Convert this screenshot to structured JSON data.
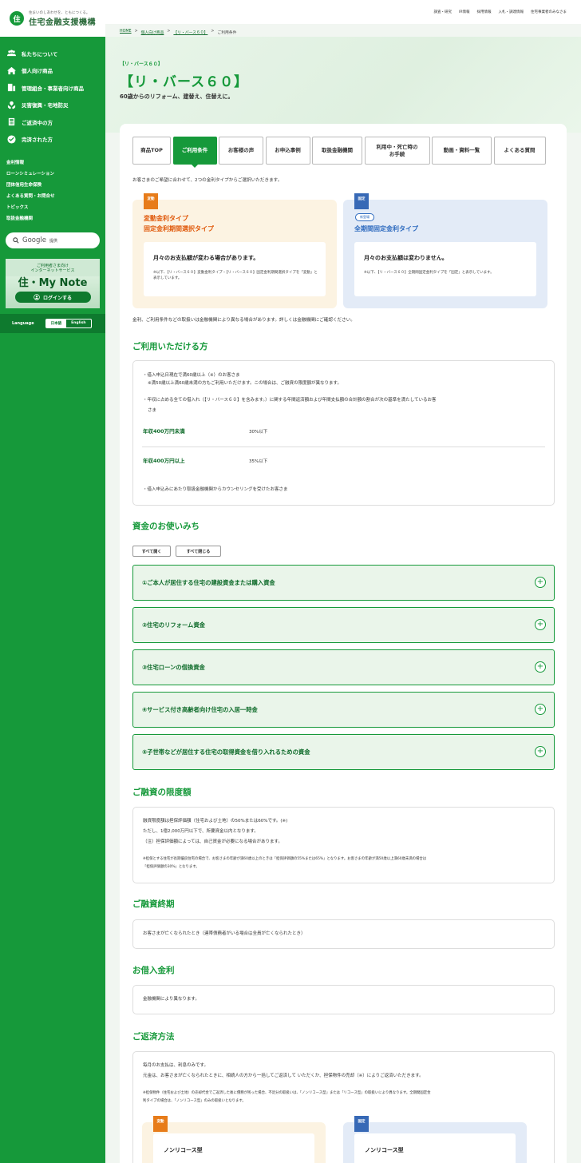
{
  "sidebar": {
    "logo_tagline": "住まいのしあわせを、ともにつくる。",
    "logo_name": "住宅金融支援機構",
    "nav": [
      {
        "label": "私たちについて",
        "icon": "people-icon"
      },
      {
        "label": "個人向け商品",
        "icon": "house-icon"
      },
      {
        "label": "管理組合・事業者向け商品",
        "icon": "building-icon"
      },
      {
        "label": "災害復興・宅地防災",
        "icon": "hands-icon"
      },
      {
        "label": "ご返済中の方",
        "icon": "calculator-icon"
      },
      {
        "label": "完済された方",
        "icon": "check-circle-icon"
      }
    ],
    "sub": [
      "金利情報",
      "ローンシミュレーション",
      "団体信用生命保険",
      "よくある質問・お問合せ",
      "トピックス",
      "取扱金融機関"
    ],
    "search_logo": "Google",
    "search_label": "提供",
    "mynote_small": "ご利用者さま向け\nインターネットサービス",
    "mynote_title": "住・My Note",
    "mynote_login": "ログインする",
    "lang_label": "Language",
    "lang_ja": "日本語",
    "lang_en": "English"
  },
  "topbar": [
    "調査・研究",
    "IR情報",
    "採用情報",
    "入札・調達情報",
    "住宅事業者のみなさま"
  ],
  "breadcrumb": {
    "home": "HOME",
    "sep": ">",
    "b1": "個人向け商品",
    "b2": "【リ・バース６０】",
    "current": "ご利用条件"
  },
  "hero": {
    "sub": "【リ・バース６０】",
    "title": "【リ・バース６０】",
    "desc": "60歳からのリフォーム、建替え、住替えに。"
  },
  "tabs": [
    "商品TOP",
    "ご利用条件",
    "お客様の声",
    "お申込事例",
    "取扱金融機関",
    "利用中・死亡時の\nお手続",
    "動画・資料一覧",
    "よくある質問"
  ],
  "intro": "お客さまのご希望に合わせて、2つの金利タイプからご選択いただきます。",
  "rate_var": {
    "tag": "変動",
    "title1": "変動金利タイプ",
    "title2": "固定金利期間選択タイプ",
    "head": "月々のお支払額が変わる場合があります。",
    "note": "※以下、【リ・バース６０】変動金利タイプ・【リ・バース６０】固定金利期間選択タイプを「変動」と表示しています。"
  },
  "rate_fix": {
    "tag": "固定",
    "new": "新登場",
    "title": "全期間固定金利タイプ",
    "head": "月々のお支払額は変わりません。",
    "note": "※以下、【リ・バース６０】全期間固定金利タイプを「固定」と表示しています。"
  },
  "rate_note": "金利、ご利用条件などの取扱いは金融機関により異なる場合があります。詳しくは金融機関にご確認ください。",
  "eligible": {
    "title": "ご利用いただける方",
    "l1": "・借入申込日現在で満60歳以上（※）のお客さま",
    "l2": "※満50歳以上満60歳未満の方もご利用いただけます。この場合は、ご融資の限度額が異なります。",
    "l3": "・年収に占める全ての借入れ（【リ・バース６０】を含みます。）に関する年間返済額および年間支払額の合計額の割合が次の基準を満たしているお客",
    "l3b": "さま",
    "row1_label": "年収400万円未満",
    "row1_val": "30%以下",
    "row2_label": "年収400万円以上",
    "row2_val": "35%以下",
    "l4": "・借入申込みにあたり取扱金融機関からカウンセリングを受けたお客さま"
  },
  "uses": {
    "title": "資金のお使いみち",
    "open_all": "すべて開く",
    "close_all": "すべて閉じる",
    "items": [
      "①ご本人が居住する住宅の建設資金または購入資金",
      "②住宅のリフォーム資金",
      "③住宅ローンの借換資金",
      "④サービス付き高齢者向け住宅の入居一時金",
      "⑤子世帯などが居住する住宅の取得資金を借り入れるための資金"
    ]
  },
  "limit": {
    "title": "ご融資の限度額",
    "l1": "融資限度額は担保評価額（住宅および土地）の50%または60%です。(※)",
    "l2": "ただし、1億2,000万円以下で、所要資金以内となります。",
    "l3": "（注）担保評価額によっては、自己資金が必要になる場合があります。",
    "n1": "※担保とする住宅が長期優良住宅の場合で、お客さまの年齢が満60歳以上のときは「担保評価額の55%または65%」となります。お客さまの年齢が満50歳以上満60歳未満の場合は",
    "n2": "「担保評価額の30%」となります。"
  },
  "term": {
    "title": "ご融資終期",
    "text": "お客さまが亡くなられたとき（連帯債務者がいる場合は全員が亡くなられたとき）"
  },
  "amount": {
    "title": "お借入金利",
    "text": "金融機関により異なります。"
  },
  "repay": {
    "title": "ご返済方法",
    "l1": "毎月のお支払は、利息のみです。",
    "l2": "元金は、お客さまが亡くなられたときに、相続人の方から一括してご返済して いただくか、担保物件の売却（※）によりご返済いただきます。",
    "n1": "※担保物件（住宅および土地）の売却代金でご返済した後に債務が残った場合、不足分の取扱いは、「ノンリコース型」または「リコース型」の取扱いにより異なります。全期間固定金",
    "n2": "利タイプの場合は、「ノンリコース型」のみの取扱いとなります。",
    "box_var_tag": "変動",
    "box_var": "ノンリコース型",
    "box_fix_tag": "固定",
    "box_fix": "ノンリコース型"
  }
}
